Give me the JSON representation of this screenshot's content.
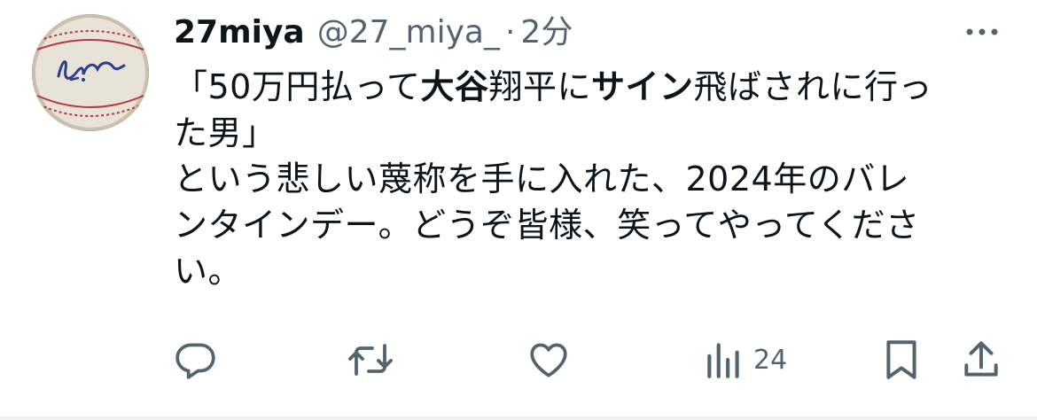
{
  "user": {
    "display_name": "27miya",
    "handle": "@27_miya_",
    "separator": "·",
    "time": "2分"
  },
  "tweet": {
    "line1": [
      {
        "text": "「50万円払って",
        "bold": false
      },
      {
        "text": "大谷",
        "bold": true
      },
      {
        "text": "翔平に",
        "bold": false
      },
      {
        "text": "サイン",
        "bold": true
      },
      {
        "text": "飛ばされに行っ",
        "bold": false
      }
    ],
    "line2": "た男」",
    "line3": "という悲しい蔑称を手に入れた、2024年のバレ",
    "line4": "ンタインデー。どうぞ皆様、笑ってやってくださ",
    "line5": "い。"
  },
  "actions": {
    "views_count": "24"
  },
  "colors": {
    "text_primary": "#0f1419",
    "text_secondary": "#536471",
    "divider": "#eef1f3"
  },
  "icons": [
    "more-icon",
    "reply-icon",
    "retweet-icon",
    "like-icon",
    "views-icon",
    "bookmark-icon",
    "share-icon"
  ]
}
